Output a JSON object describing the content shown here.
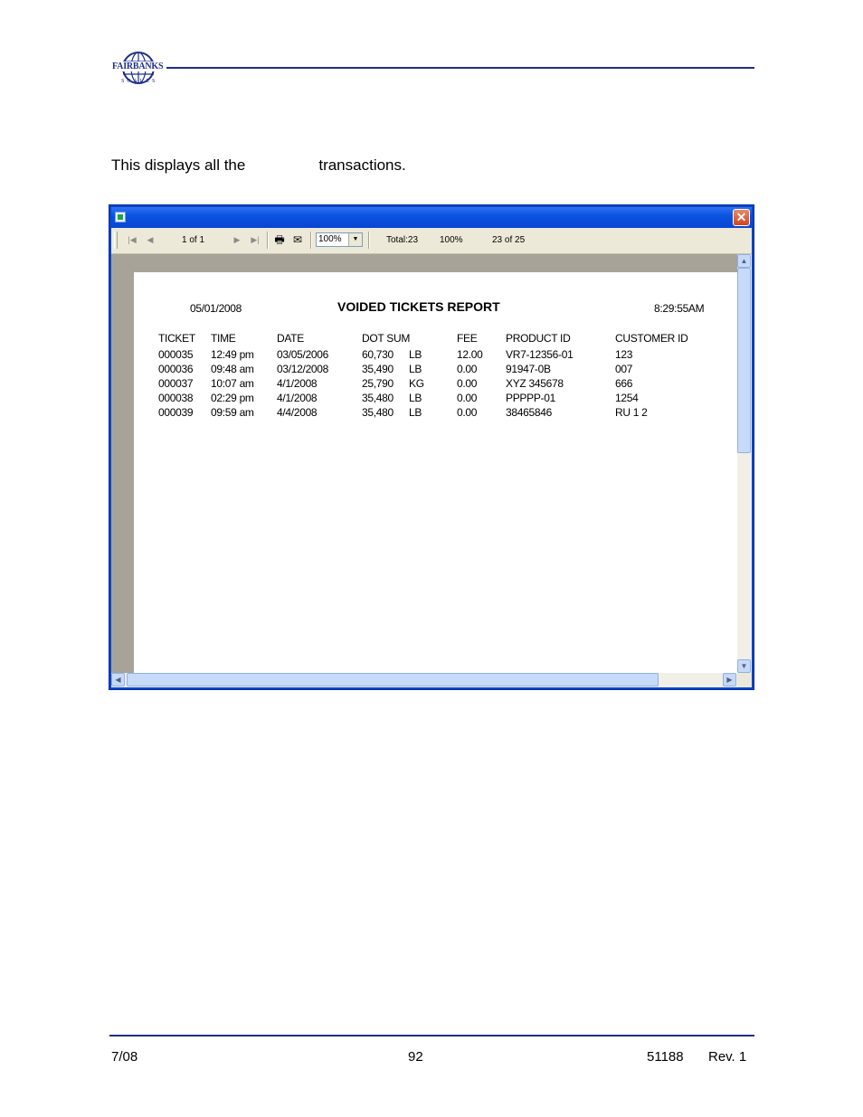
{
  "header": {
    "logo_text": "FAIRBANKS",
    "logo_sub": "SCALES"
  },
  "intro": {
    "text_before": "This displays all the",
    "text_after": "transactions."
  },
  "window": {
    "toolbar": {
      "page_indicator": "1 of 1",
      "zoom_value": "100%",
      "total_label": "Total:23",
      "percent": "100%",
      "record_count": "23 of 25"
    },
    "report": {
      "date": "05/01/2008",
      "title": "VOIDED TICKETS REPORT",
      "time": "8:29:55AM",
      "columns": [
        "TICKET",
        "TIME",
        "DATE",
        "DOT SUM",
        "",
        "FEE",
        "PRODUCT  ID",
        "CUSTOMER  ID"
      ],
      "rows": [
        [
          "000035",
          "12:49 pm",
          "03/05/2006",
          "60,730",
          "LB",
          "12.00",
          "VR7-12356-01",
          "123"
        ],
        [
          "000036",
          "09:48 am",
          "03/12/2008",
          "35,490",
          "LB",
          "0.00",
          "91947-0B",
          "007"
        ],
        [
          "000037",
          "10:07 am",
          "4/1/2008",
          "25,790",
          "KG",
          "0.00",
          "XYZ 345678",
          "666"
        ],
        [
          "000038",
          "02:29 pm",
          "4/1/2008",
          "35,480",
          "LB",
          "0.00",
          "PPPPP-01",
          "1254"
        ],
        [
          "000039",
          "09:59 am",
          "4/4/2008",
          "35,480",
          "LB",
          "0.00",
          "38465846",
          "RU 1 2"
        ]
      ]
    }
  },
  "footer": {
    "date": "7/08",
    "page": "92",
    "doc_number": "51188",
    "revision": "Rev. 1"
  }
}
